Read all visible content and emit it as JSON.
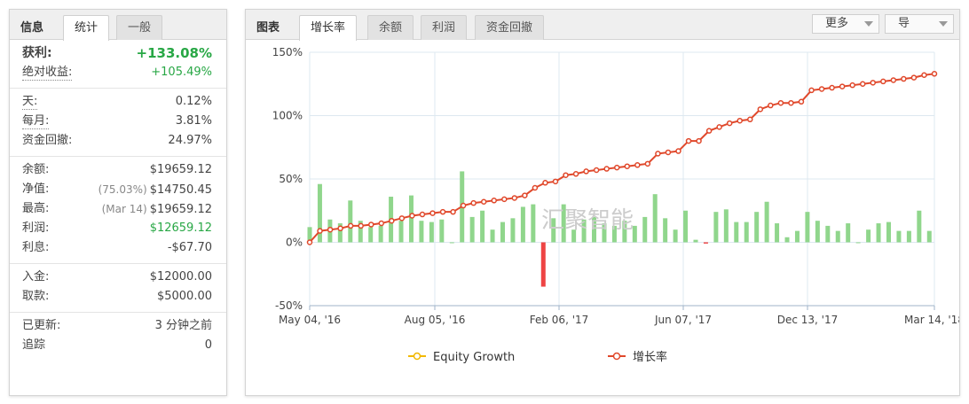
{
  "left": {
    "tabs": [
      "信息",
      "统计",
      "一般"
    ],
    "groups": [
      [
        {
          "label": "获利:",
          "value": "+133.08%",
          "green": true,
          "big": true
        },
        {
          "label": "绝对收益:",
          "value": "+105.49%",
          "green": true,
          "dotted": true
        }
      ],
      [
        {
          "label": "天:",
          "value": "0.12%",
          "dotted": true
        },
        {
          "label": "每月:",
          "value": "3.81%",
          "dotted": true
        },
        {
          "label": "资金回撤:",
          "value": "24.97%"
        }
      ],
      [
        {
          "label": "余额:",
          "value": "$19659.12"
        },
        {
          "label": "净值:",
          "pre": "(75.03%)",
          "value": "$14750.45"
        },
        {
          "label": "最高:",
          "pre": "(Mar 14)",
          "value": "$19659.12"
        },
        {
          "label": "利润:",
          "value": "$12659.12",
          "green": true
        },
        {
          "label": "利息:",
          "value": "-$67.70"
        }
      ],
      [
        {
          "label": "入金:",
          "value": "$12000.00"
        },
        {
          "label": "取款:",
          "value": "$5000.00"
        }
      ],
      [
        {
          "label": "已更新:",
          "value": "3 分钟之前"
        },
        {
          "label": "追踪",
          "value": "0"
        }
      ]
    ]
  },
  "right": {
    "title": "图表",
    "tabs": [
      "增长率",
      "余额",
      "利润",
      "资金回撤"
    ],
    "more_label": "更多",
    "export_label": "导"
  },
  "colors": {
    "bar_positive": "#90d68c",
    "bar_negative": "#ee4444",
    "line": "#e0482b",
    "equity_legend": "#f2b800",
    "grid": "#dde8f0"
  },
  "watermark": "汇聚智能",
  "chart_data": {
    "type": "bar",
    "y_ticks": [
      "150%",
      "100%",
      "50%",
      "0%",
      "-50%"
    ],
    "ylim": [
      -50,
      150
    ],
    "x_ticks": [
      "May 04, '16",
      "Aug 05, '16",
      "Feb 06, '17",
      "Jun 07, '17",
      "Dec 13, '17",
      "Mar 14, '18"
    ],
    "legend": [
      "Equity Growth",
      "增长率"
    ],
    "bars": [
      12,
      46,
      18,
      15,
      33,
      17,
      12,
      13,
      36,
      17,
      37,
      17,
      16,
      18,
      0,
      56,
      20,
      25,
      10,
      16,
      19,
      28,
      30,
      -35,
      19,
      30,
      10,
      18,
      20,
      15,
      13,
      17,
      13,
      20,
      38,
      19,
      10,
      25,
      2,
      -1,
      24,
      26,
      16,
      16,
      24,
      32,
      15,
      4,
      9,
      24,
      17,
      13,
      9,
      15,
      0,
      10,
      15,
      16,
      9,
      9,
      25,
      9
    ],
    "growth": [
      0,
      9,
      10,
      11,
      13,
      13,
      14,
      15,
      17,
      19,
      21,
      22,
      23,
      24,
      24,
      29,
      31,
      32,
      33,
      34,
      35,
      37,
      43,
      47,
      48,
      53,
      54,
      56,
      57,
      58,
      59,
      60,
      61,
      62,
      70,
      71,
      72,
      80,
      80,
      88,
      91,
      94,
      96,
      97,
      105,
      108,
      110,
      110,
      111,
      120,
      121,
      122,
      123,
      124,
      125,
      126,
      127,
      128,
      129,
      130,
      132,
      133
    ]
  }
}
